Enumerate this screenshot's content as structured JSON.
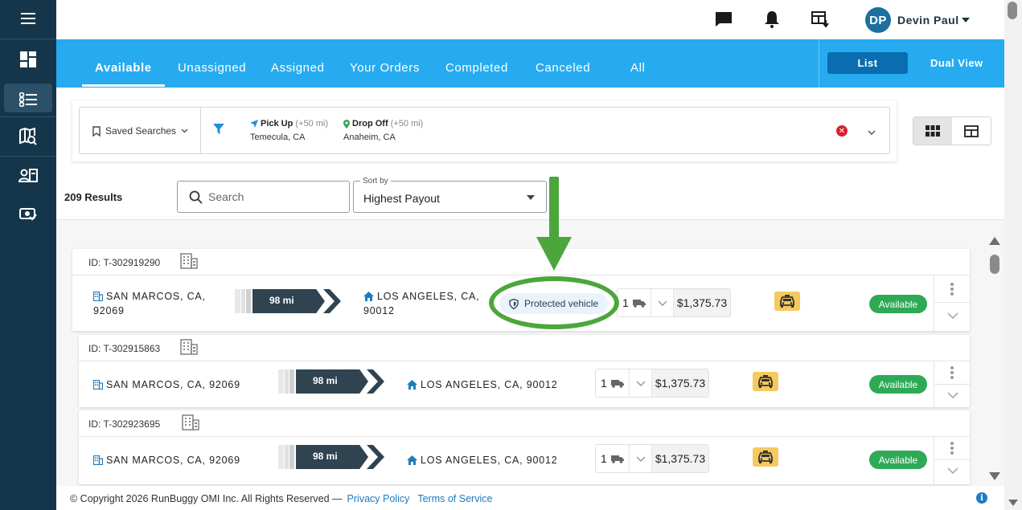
{
  "user": {
    "initials": "DP",
    "name": "Devin Paul"
  },
  "tabs": [
    {
      "label": "Available",
      "active": true
    },
    {
      "label": "Unassigned"
    },
    {
      "label": "Assigned"
    },
    {
      "label": "Your Orders"
    },
    {
      "label": "Completed"
    },
    {
      "label": "Canceled"
    },
    {
      "label": "All"
    }
  ],
  "view": {
    "list": "List",
    "dual": "Dual View"
  },
  "filters": {
    "saved_searches": "Saved Searches",
    "pickup": {
      "label": "Pick Up",
      "radius": "(+50 mi)",
      "city": "Temecula, CA"
    },
    "dropoff": {
      "label": "Drop Off",
      "radius": "(+50 mi)",
      "city": "Anaheim, CA"
    }
  },
  "results": {
    "count_label": "209 Results"
  },
  "search": {
    "placeholder": "Search"
  },
  "sort": {
    "label": "Sort by",
    "value": "Highest Payout"
  },
  "orders": [
    {
      "id": "ID: T-302919290",
      "origin_line1": "SAN MARCOS, CA,",
      "origin_line2": "92069",
      "distance": "98 mi",
      "dest_line1": "LOS ANGELES, CA,",
      "dest_line2": "90012",
      "badge": "Protected vehicle",
      "qty": "1",
      "price": "$1,375.73",
      "status": "Available"
    },
    {
      "id": "ID: T-302915863",
      "origin": "SAN MARCOS, CA, 92069",
      "distance": "98 mi",
      "dest": "LOS ANGELES, CA, 90012",
      "qty": "1",
      "price": "$1,375.73",
      "status": "Available"
    },
    {
      "id": "ID: T-302923695",
      "origin": "SAN MARCOS, CA, 92069",
      "distance": "98 mi",
      "dest": "LOS ANGELES, CA, 90012",
      "qty": "1",
      "price": "$1,375.73",
      "status": "Available"
    }
  ],
  "footer": {
    "copyright": "© Copyright 2026 RunBuggy OMI Inc. All Rights Reserved —",
    "privacy": "Privacy Policy",
    "terms": "Terms of Service",
    "info": "i"
  },
  "colors": {
    "sidebar": "#15364a",
    "nav": "#26abf0",
    "accent_button": "#0a6db0",
    "status_available": "#2eaa56",
    "annotation_green": "#4ca63c"
  }
}
